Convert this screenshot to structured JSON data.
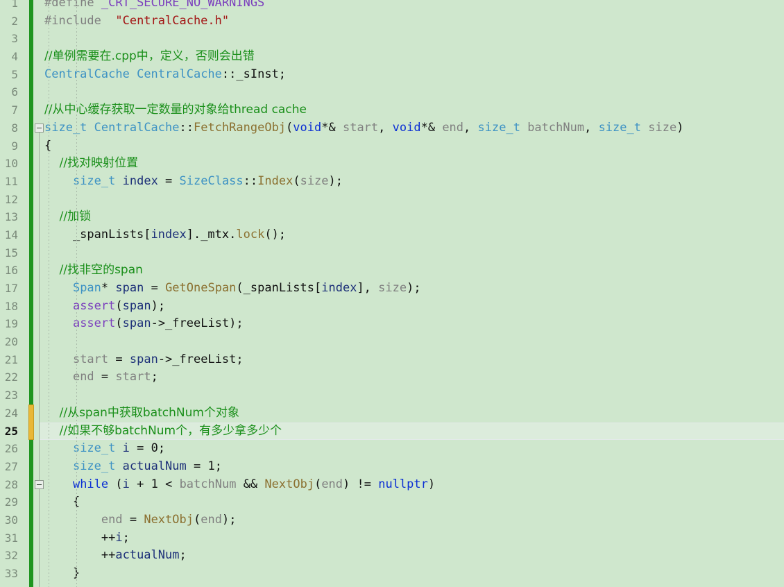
{
  "editor": {
    "app": "code-editor",
    "language": "C++",
    "file_reference": "CentralCache.cpp",
    "line_height_px": 25.7,
    "first_visible_line": 1,
    "current_line": 25,
    "colors": {
      "background": "#cfe7cd",
      "current_line_background": "#dcecdc",
      "saved_marker": "#1f9520",
      "modified_marker": "#e9b737",
      "comment": "#1a8f1a",
      "keyword": "#0b2fd4",
      "type": "#3d92c4",
      "string": "#a31515",
      "macro": "#7b3fbd",
      "function": "#8b7030",
      "parameter": "#808080",
      "local_variable": "#1c2f78",
      "line_number": "#7a8a7a"
    }
  },
  "gutter": {
    "line_numbers": [
      "1",
      "2",
      "3",
      "4",
      "5",
      "6",
      "7",
      "8",
      "9",
      "10",
      "11",
      "12",
      "13",
      "14",
      "15",
      "16",
      "17",
      "18",
      "19",
      "20",
      "21",
      "22",
      "23",
      "24",
      "25",
      "26",
      "27",
      "28",
      "29",
      "30",
      "31",
      "32",
      "33"
    ],
    "modified_lines": [
      24,
      25
    ],
    "fold_markers": [
      {
        "line": 8,
        "state": "expanded",
        "glyph": "minus"
      },
      {
        "line": 28,
        "state": "expanded",
        "glyph": "minus"
      }
    ]
  },
  "code_lines": [
    {
      "n": 1,
      "tokens": [
        {
          "t": "#define ",
          "c": "pre"
        },
        {
          "t": "_CRT_SECURE_NO_WARNINGS",
          "c": "macro"
        }
      ]
    },
    {
      "n": 2,
      "tokens": [
        {
          "t": "#include  ",
          "c": "pre"
        },
        {
          "t": "\"CentralCache.h\"",
          "c": "string"
        }
      ]
    },
    {
      "n": 3,
      "tokens": []
    },
    {
      "n": 4,
      "tokens": [
        {
          "t": "//单例需要在.cpp中，定义，否则会出错",
          "c": "comment"
        }
      ]
    },
    {
      "n": 5,
      "tokens": [
        {
          "t": "CentralCache",
          "c": "type"
        },
        {
          "t": " ",
          "c": "plain"
        },
        {
          "t": "CentralCache",
          "c": "type"
        },
        {
          "t": "::_sInst;",
          "c": "plain"
        }
      ]
    },
    {
      "n": 6,
      "tokens": []
    },
    {
      "n": 7,
      "tokens": [
        {
          "t": "//从中心缓存获取一定数量的对象给thread cache",
          "c": "comment"
        }
      ]
    },
    {
      "n": 8,
      "tokens": [
        {
          "t": "size_t",
          "c": "type"
        },
        {
          "t": " ",
          "c": "plain"
        },
        {
          "t": "CentralCache",
          "c": "type"
        },
        {
          "t": "::",
          "c": "plain"
        },
        {
          "t": "FetchRangeObj",
          "c": "func"
        },
        {
          "t": "(",
          "c": "plain"
        },
        {
          "t": "void",
          "c": "keyword"
        },
        {
          "t": "*& ",
          "c": "plain"
        },
        {
          "t": "start",
          "c": "param"
        },
        {
          "t": ", ",
          "c": "plain"
        },
        {
          "t": "void",
          "c": "keyword"
        },
        {
          "t": "*& ",
          "c": "plain"
        },
        {
          "t": "end",
          "c": "param"
        },
        {
          "t": ", ",
          "c": "plain"
        },
        {
          "t": "size_t",
          "c": "type"
        },
        {
          "t": " ",
          "c": "plain"
        },
        {
          "t": "batchNum",
          "c": "param"
        },
        {
          "t": ", ",
          "c": "plain"
        },
        {
          "t": "size_t",
          "c": "type"
        },
        {
          "t": " ",
          "c": "plain"
        },
        {
          "t": "size",
          "c": "param"
        },
        {
          "t": ")",
          "c": "plain"
        }
      ]
    },
    {
      "n": 9,
      "tokens": [
        {
          "t": "{",
          "c": "plain"
        }
      ]
    },
    {
      "n": 10,
      "tokens": [
        {
          "t": "    //找对映射位置",
          "c": "comment"
        }
      ]
    },
    {
      "n": 11,
      "tokens": [
        {
          "t": "    ",
          "c": "plain"
        },
        {
          "t": "size_t",
          "c": "type"
        },
        {
          "t": " ",
          "c": "plain"
        },
        {
          "t": "index",
          "c": "local"
        },
        {
          "t": " = ",
          "c": "plain"
        },
        {
          "t": "SizeClass",
          "c": "type"
        },
        {
          "t": "::",
          "c": "plain"
        },
        {
          "t": "Index",
          "c": "func"
        },
        {
          "t": "(",
          "c": "plain"
        },
        {
          "t": "size",
          "c": "param"
        },
        {
          "t": ");",
          "c": "plain"
        }
      ]
    },
    {
      "n": 12,
      "tokens": []
    },
    {
      "n": 13,
      "tokens": [
        {
          "t": "    //加锁",
          "c": "comment"
        }
      ]
    },
    {
      "n": 14,
      "tokens": [
        {
          "t": "    _spanLists[",
          "c": "plain"
        },
        {
          "t": "index",
          "c": "local"
        },
        {
          "t": "]._mtx.",
          "c": "plain"
        },
        {
          "t": "lock",
          "c": "func"
        },
        {
          "t": "();",
          "c": "plain"
        }
      ]
    },
    {
      "n": 15,
      "tokens": []
    },
    {
      "n": 16,
      "tokens": [
        {
          "t": "    //找非空的span",
          "c": "comment"
        }
      ]
    },
    {
      "n": 17,
      "tokens": [
        {
          "t": "    ",
          "c": "plain"
        },
        {
          "t": "Span",
          "c": "type"
        },
        {
          "t": "* ",
          "c": "plain"
        },
        {
          "t": "span",
          "c": "local"
        },
        {
          "t": " = ",
          "c": "plain"
        },
        {
          "t": "GetOneSpan",
          "c": "func"
        },
        {
          "t": "(_spanLists[",
          "c": "plain"
        },
        {
          "t": "index",
          "c": "local"
        },
        {
          "t": "], ",
          "c": "plain"
        },
        {
          "t": "size",
          "c": "param"
        },
        {
          "t": ");",
          "c": "plain"
        }
      ]
    },
    {
      "n": 18,
      "tokens": [
        {
          "t": "    ",
          "c": "plain"
        },
        {
          "t": "assert",
          "c": "macro"
        },
        {
          "t": "(",
          "c": "plain"
        },
        {
          "t": "span",
          "c": "local"
        },
        {
          "t": ");",
          "c": "plain"
        }
      ]
    },
    {
      "n": 19,
      "tokens": [
        {
          "t": "    ",
          "c": "plain"
        },
        {
          "t": "assert",
          "c": "macro"
        },
        {
          "t": "(",
          "c": "plain"
        },
        {
          "t": "span",
          "c": "local"
        },
        {
          "t": "->_freeList);",
          "c": "plain"
        }
      ]
    },
    {
      "n": 20,
      "tokens": []
    },
    {
      "n": 21,
      "tokens": [
        {
          "t": "    ",
          "c": "plain"
        },
        {
          "t": "start",
          "c": "param"
        },
        {
          "t": " = ",
          "c": "plain"
        },
        {
          "t": "span",
          "c": "local"
        },
        {
          "t": "->_freeList;",
          "c": "plain"
        }
      ]
    },
    {
      "n": 22,
      "tokens": [
        {
          "t": "    ",
          "c": "plain"
        },
        {
          "t": "end",
          "c": "param"
        },
        {
          "t": " = ",
          "c": "plain"
        },
        {
          "t": "start",
          "c": "param"
        },
        {
          "t": ";",
          "c": "plain"
        }
      ]
    },
    {
      "n": 23,
      "tokens": []
    },
    {
      "n": 24,
      "tokens": [
        {
          "t": "    //从span中获取batchNum个对象",
          "c": "comment"
        }
      ]
    },
    {
      "n": 25,
      "tokens": [
        {
          "t": "    //如果不够batchNum个，有多少拿多少个",
          "c": "comment"
        }
      ]
    },
    {
      "n": 26,
      "tokens": [
        {
          "t": "    ",
          "c": "plain"
        },
        {
          "t": "size_t",
          "c": "type"
        },
        {
          "t": " ",
          "c": "plain"
        },
        {
          "t": "i",
          "c": "local"
        },
        {
          "t": " = ",
          "c": "plain"
        },
        {
          "t": "0",
          "c": "num"
        },
        {
          "t": ";",
          "c": "plain"
        }
      ]
    },
    {
      "n": 27,
      "tokens": [
        {
          "t": "    ",
          "c": "plain"
        },
        {
          "t": "size_t",
          "c": "type"
        },
        {
          "t": " ",
          "c": "plain"
        },
        {
          "t": "actualNum",
          "c": "local"
        },
        {
          "t": " = ",
          "c": "plain"
        },
        {
          "t": "1",
          "c": "num"
        },
        {
          "t": ";",
          "c": "plain"
        }
      ]
    },
    {
      "n": 28,
      "tokens": [
        {
          "t": "    ",
          "c": "plain"
        },
        {
          "t": "while",
          "c": "keyword"
        },
        {
          "t": " (",
          "c": "plain"
        },
        {
          "t": "i",
          "c": "local"
        },
        {
          "t": " + ",
          "c": "plain"
        },
        {
          "t": "1",
          "c": "num"
        },
        {
          "t": " < ",
          "c": "plain"
        },
        {
          "t": "batchNum",
          "c": "param"
        },
        {
          "t": " && ",
          "c": "plain"
        },
        {
          "t": "NextObj",
          "c": "func"
        },
        {
          "t": "(",
          "c": "plain"
        },
        {
          "t": "end",
          "c": "param"
        },
        {
          "t": ") != ",
          "c": "plain"
        },
        {
          "t": "nullptr",
          "c": "keyword"
        },
        {
          "t": ")",
          "c": "plain"
        }
      ]
    },
    {
      "n": 29,
      "tokens": [
        {
          "t": "    {",
          "c": "plain"
        }
      ]
    },
    {
      "n": 30,
      "tokens": [
        {
          "t": "        ",
          "c": "plain"
        },
        {
          "t": "end",
          "c": "param"
        },
        {
          "t": " = ",
          "c": "plain"
        },
        {
          "t": "NextObj",
          "c": "func"
        },
        {
          "t": "(",
          "c": "plain"
        },
        {
          "t": "end",
          "c": "param"
        },
        {
          "t": ");",
          "c": "plain"
        }
      ]
    },
    {
      "n": 31,
      "tokens": [
        {
          "t": "        ++",
          "c": "plain"
        },
        {
          "t": "i",
          "c": "local"
        },
        {
          "t": ";",
          "c": "plain"
        }
      ]
    },
    {
      "n": 32,
      "tokens": [
        {
          "t": "        ++",
          "c": "plain"
        },
        {
          "t": "actualNum",
          "c": "local"
        },
        {
          "t": ";",
          "c": "plain"
        }
      ]
    },
    {
      "n": 33,
      "tokens": [
        {
          "t": "    }",
          "c": "plain"
        }
      ]
    }
  ]
}
